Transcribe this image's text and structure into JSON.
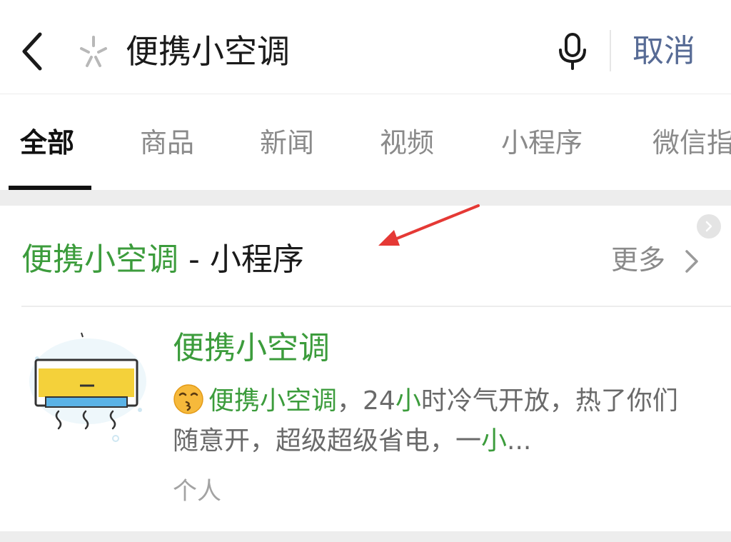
{
  "search": {
    "query": "便携小空调",
    "cancel_label": "取消"
  },
  "tabs": [
    {
      "label": "全部",
      "active": true
    },
    {
      "label": "商品"
    },
    {
      "label": "新闻"
    },
    {
      "label": "视频"
    },
    {
      "label": "小程序"
    },
    {
      "label": "微信指"
    }
  ],
  "section": {
    "title_highlight": "便携小空调",
    "title_suffix": " - 小程序",
    "more_label": "更多"
  },
  "result": {
    "title": "便携小空调",
    "desc_part1": "便携小空调",
    "desc_part2": "，24",
    "desc_part3": "小",
    "desc_part4": "时冷气开放，热了你们随意开，超级超级省电，一",
    "desc_part5": "小",
    "desc_part6": "...",
    "meta": "个人"
  },
  "colors": {
    "highlight": "#3c9c3c",
    "link": "#576b95",
    "annotation_arrow": "#e53935"
  },
  "icons": {
    "back": "chevron-left-icon",
    "logo": "sparkle-icon",
    "mic": "microphone-icon",
    "more": "chevron-right-icon",
    "emoji": "kissing-face-emoji"
  }
}
